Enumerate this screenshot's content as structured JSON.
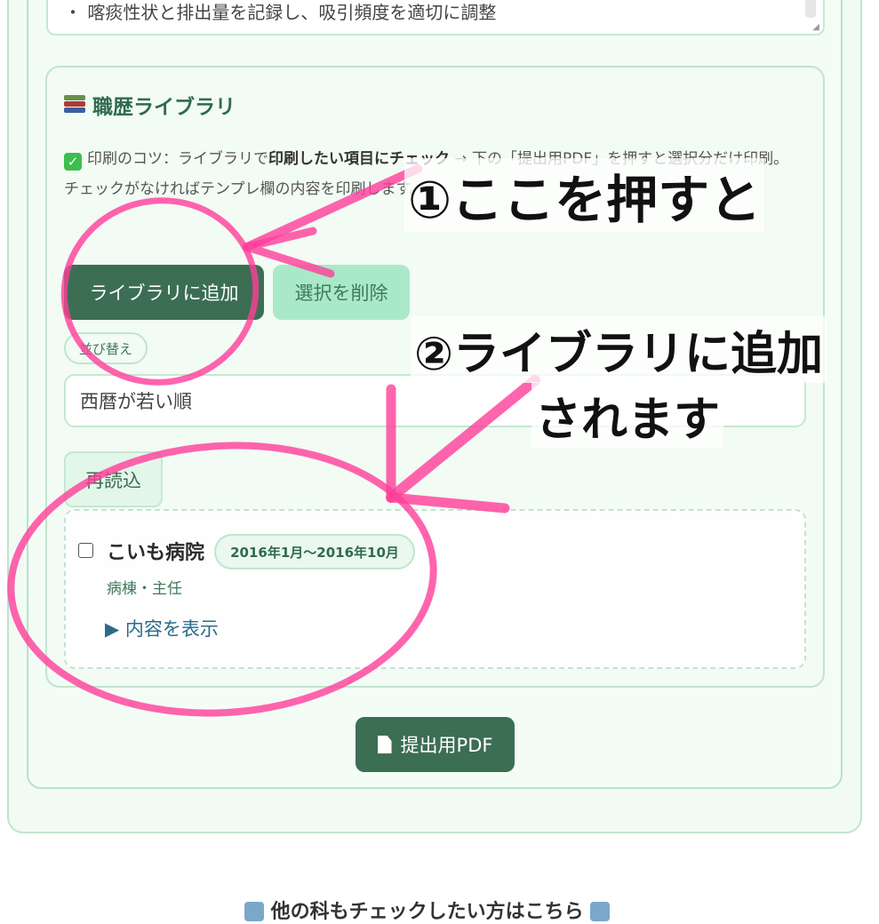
{
  "top_textarea": {
    "text": "・ 喀痰性状と排出量を記録し、吸引頻度を適切に調整"
  },
  "library": {
    "title": "職歴ライブラリ",
    "tip_prefix": "印刷のコツ：ライブラリで",
    "tip_bold": "印刷したい項目にチェック",
    "tip_suffix": " → 下の「提出用PDF」を押すと選択分だけ印刷。",
    "tip_line2": "チェックがなければテンプレ欄の内容を印刷します。",
    "add_button": "ライブラリに追加",
    "delete_button": "選択を削除",
    "sort_chip": "並び替え",
    "sort_select": "西暦が若い順",
    "reload_button": "再読込",
    "entries": [
      {
        "name": "こいも病院",
        "period": "2016年1月〜2016年10月",
        "role": "病棟・主任",
        "toggle": "▶ 内容を表示"
      }
    ]
  },
  "pdf_button": "提出用PDF",
  "bottom_text": "他の科もチェックしたい方はこちら",
  "annotations": {
    "step1": "①ここを押すと",
    "step2_line1": "②ライブラリに追加",
    "step2_line2": "されます",
    "color": "#ff3d9a"
  },
  "colors": {
    "primary": "#3c6e54",
    "secondary": "#a9e9c9",
    "panel_bg": "#f2fbf4",
    "border": "#bfe6cd",
    "link": "#2c6a8a"
  }
}
